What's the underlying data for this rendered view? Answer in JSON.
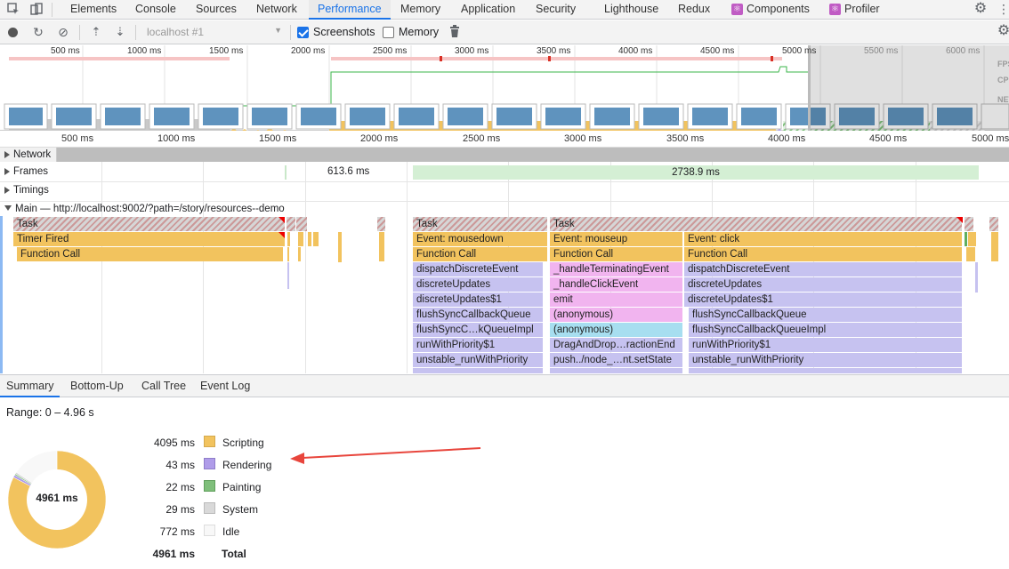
{
  "tabs": [
    "Elements",
    "Console",
    "Sources",
    "Network",
    "Performance",
    "Memory",
    "Application",
    "Security",
    "Lighthouse",
    "Redux",
    "Components",
    "Profiler"
  ],
  "active_tab": "Performance",
  "toolbar": {
    "profile_select": "localhost #1",
    "screenshots_label": "Screenshots",
    "memory_label": "Memory",
    "screenshots_checked": true,
    "memory_checked": false
  },
  "overview": {
    "ticks": [
      "500 ms",
      "1000 ms",
      "1500 ms",
      "2000 ms",
      "2500 ms",
      "3000 ms",
      "3500 ms",
      "4000 ms",
      "4500 ms",
      "5000 ms",
      "5500 ms",
      "6000 ms"
    ],
    "lane_labels": [
      "FPS",
      "CPU",
      "NET"
    ]
  },
  "ruler": {
    "ticks": [
      "500 ms",
      "1000 ms",
      "1500 ms",
      "2000 ms",
      "2500 ms",
      "3000 ms",
      "3500 ms",
      "4000 ms",
      "4500 ms",
      "5000 ms"
    ]
  },
  "tracks": {
    "network": "Network",
    "frames": "Frames",
    "frame_values": [
      "613.6 ms",
      "2738.9 ms"
    ],
    "timings": "Timings",
    "main": "Main — http://localhost:9002/?path=/story/resources--demo"
  },
  "flame": {
    "col1": [
      "Task",
      "Timer Fired",
      "Function Call"
    ],
    "col2": [
      "Task",
      "Event: mousedown",
      "Function Call",
      "dispatchDiscreteEvent",
      "discreteUpdates",
      "discreteUpdates$1",
      "flushSyncCallbackQueue",
      "flushSyncC…kQueueImpl",
      "runWithPriority$1",
      "unstable_runWithPriority"
    ],
    "col3": [
      "Task",
      "Event: mouseup",
      "Function Call",
      "_handleTerminatingEvent",
      "_handleClickEvent",
      "emit",
      "(anonymous)",
      "(anonymous)",
      "DragAndDrop…ractionEnd",
      "push../node_…nt.setState"
    ],
    "col4": [
      "Event: click",
      "Function Call",
      "dispatchDiscreteEvent",
      "discreteUpdates",
      "discreteUpdates$1",
      "flushSyncCallbackQueue",
      "flushSyncCallbackQueueImpl",
      "runWithPriority$1",
      "unstable_runWithPriority"
    ]
  },
  "bottom_tabs": [
    "Summary",
    "Bottom-Up",
    "Call Tree",
    "Event Log"
  ],
  "summary": {
    "range": "Range: 0 – 4.96 s",
    "total_center": "4961 ms",
    "rows": [
      {
        "value": "4095 ms",
        "label": "Scripting",
        "color": "#f2c35e",
        "ms": 4095
      },
      {
        "value": "43 ms",
        "label": "Rendering",
        "color": "#af9ce9",
        "ms": 43
      },
      {
        "value": "22 ms",
        "label": "Painting",
        "color": "#7fbf7b",
        "ms": 22
      },
      {
        "value": "29 ms",
        "label": "System",
        "color": "#d9d9d9",
        "ms": 29
      },
      {
        "value": "772 ms",
        "label": "Idle",
        "color": "#f8f8f8",
        "ms": 772
      }
    ],
    "total_value": "4961 ms",
    "total_label": "Total"
  },
  "colors": {
    "accent": "#1a73e8",
    "scripting": "#f2c35e",
    "arrow": "#e8453c"
  }
}
